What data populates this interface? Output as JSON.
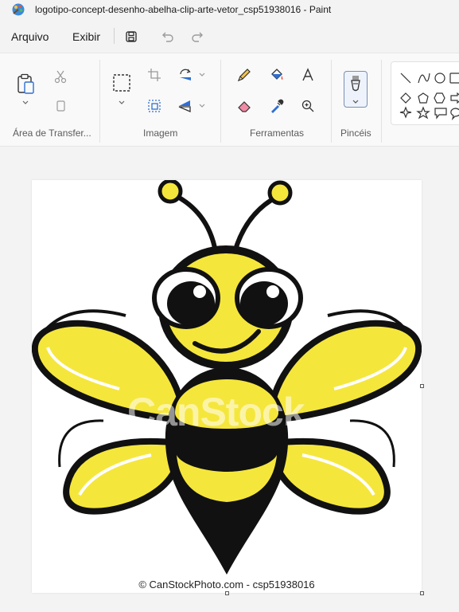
{
  "window": {
    "title": "logotipo-concept-desenho-abelha-clip-arte-vetor_csp51938016 - Paint"
  },
  "menu": {
    "items": [
      "Arquivo",
      "Exibir"
    ]
  },
  "quick_access": {
    "icons": [
      "save-icon",
      "undo-icon",
      "redo-icon"
    ]
  },
  "ribbon": {
    "groups": [
      {
        "label": "Área de Transfer..."
      },
      {
        "label": "Imagem"
      },
      {
        "label": "Ferramentas"
      },
      {
        "label": "Pincéis"
      }
    ]
  },
  "canvas": {
    "watermark": "CanStock",
    "copyright": "© CanStockPhoto.com - csp51938016"
  },
  "colors": {
    "bee_yellow": "#f5e63c",
    "bee_black": "#111111",
    "selection_blue": "#2f6fd1"
  }
}
